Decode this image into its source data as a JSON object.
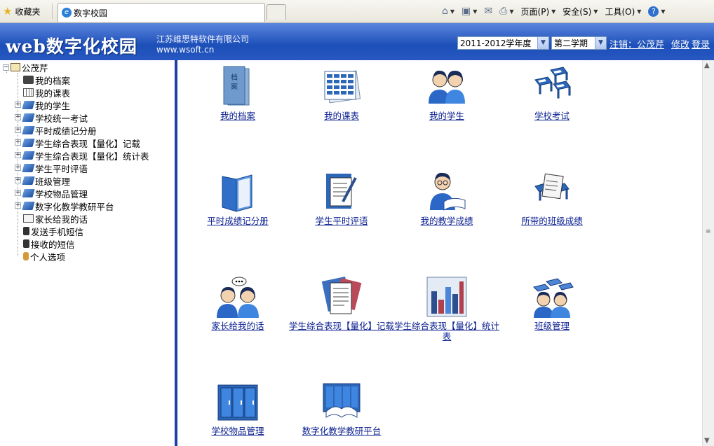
{
  "browser": {
    "favorites_label": "收藏夹",
    "tab_title": "数字校园",
    "tools": [
      "页面(P)",
      "安全(S)",
      "工具(O)"
    ]
  },
  "header": {
    "logo": "web数字化校园",
    "company_line1": "江苏维思特软件有限公司",
    "company_line2": "www.wsoft.cn",
    "year_select": "2011-2012学年度",
    "term_select": "第二学期",
    "logout_label": "注销：公茂芹",
    "modify_label": "修改",
    "login_label": "登录"
  },
  "tree": {
    "root": "公茂芹",
    "items": [
      {
        "label": "我的档案",
        "icon": "profile-icon",
        "expand": false
      },
      {
        "label": "我的课表",
        "icon": "schedule-icon",
        "expand": false
      },
      {
        "label": "我的学生",
        "icon": "book-icon",
        "expand": true
      },
      {
        "label": "学校统一考试",
        "icon": "book-icon",
        "expand": true
      },
      {
        "label": "平时成绩记分册",
        "icon": "book-icon",
        "expand": true
      },
      {
        "label": "学生综合表现【量化】记载",
        "icon": "book-icon",
        "expand": true
      },
      {
        "label": "学生综合表现【量化】统计表",
        "icon": "book-icon",
        "expand": true
      },
      {
        "label": "学生平时评语",
        "icon": "book-icon",
        "expand": true
      },
      {
        "label": "班级管理",
        "icon": "book-icon",
        "expand": true
      },
      {
        "label": "学校物品管理",
        "icon": "book-icon",
        "expand": true
      },
      {
        "label": "数字化教学教研平台",
        "icon": "book-icon",
        "expand": true
      },
      {
        "label": "家长给我的话",
        "icon": "note-icon",
        "expand": false
      },
      {
        "label": "发送手机短信",
        "icon": "phone-icon",
        "expand": false
      },
      {
        "label": "接收的短信",
        "icon": "phone-icon",
        "expand": false
      },
      {
        "label": "个人选项",
        "icon": "person-icon",
        "expand": false
      }
    ]
  },
  "tiles": [
    {
      "label": "我的档案",
      "icon": "archive-icon"
    },
    {
      "label": "我的课表",
      "icon": "timetable-icon"
    },
    {
      "label": "我的学生",
      "icon": "students-icon"
    },
    {
      "label": "学校考试",
      "icon": "exam-desks-icon"
    },
    {
      "label": "平时成绩记分册",
      "icon": "gradebook-icon"
    },
    {
      "label": "学生平时评语",
      "icon": "comments-icon"
    },
    {
      "label": "我的教学成绩",
      "icon": "teacher-reading-icon"
    },
    {
      "label": "所带的班级成绩",
      "icon": "class-scores-icon"
    },
    {
      "label": "家长给我的话",
      "icon": "parents-talk-icon"
    },
    {
      "label": "学生综合表现【量化】记载",
      "icon": "record-docs-icon"
    },
    {
      "label": "学生综合表现【量化】统计表",
      "icon": "bar-stats-icon"
    },
    {
      "label": "班级管理",
      "icon": "class-manage-icon"
    },
    {
      "label": "学校物品管理",
      "icon": "lockers-icon"
    },
    {
      "label": "数字化教学教研平台",
      "icon": "open-book-icon"
    }
  ]
}
